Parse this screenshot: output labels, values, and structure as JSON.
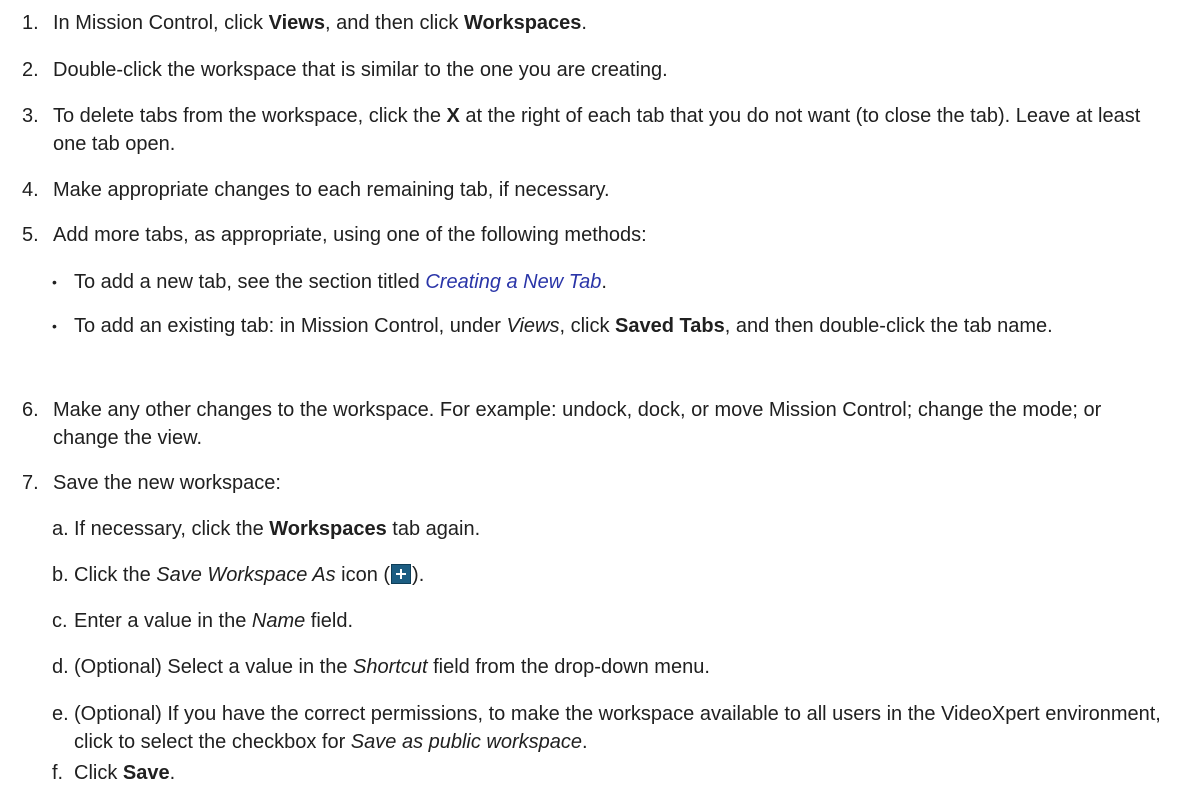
{
  "steps": [
    {
      "num": "1.",
      "t1": "In Mission Control, click ",
      "b1": "Views",
      "t2": ", and then click ",
      "b2": "Workspaces",
      "t3": "."
    },
    {
      "num": "2.",
      "text": "Double-click the workspace that is similar to the one you are creating."
    },
    {
      "num": "3.",
      "t1": "To delete tabs from the workspace, click the ",
      "b1": "X",
      "t2": " at the right of each tab that you do not want (to close the tab). Leave at least one tab open."
    },
    {
      "num": "4.",
      "text": "Make appropriate changes to each remaining tab, if necessary."
    },
    {
      "num": "5.",
      "text": "Add more tabs, as appropriate, using one of the following methods:"
    },
    {
      "num": "6.",
      "text": "Make any other changes to the workspace. For example: undock, dock, or move Mission Control; change the mode; or change the view."
    },
    {
      "num": "7.",
      "text": "Save the new workspace:"
    }
  ],
  "bullets": [
    {
      "marker": "•",
      "t1": "To add a new tab, see the section titled ",
      "link": "Creating a New Tab",
      "t2": "."
    },
    {
      "marker": "•",
      "t1": "To add an existing tab: in Mission Control, under ",
      "i1": "Views",
      "t2": ", click ",
      "b1": "Saved Tabs",
      "t3": ", and then double-click the tab name."
    }
  ],
  "substeps": [
    {
      "num": "a.",
      "t1": "If necessary, click the ",
      "b1": "Workspaces",
      "t2": " tab again."
    },
    {
      "num": "b.",
      "t1": "Click the ",
      "i1": "Save Workspace As",
      "t2": " icon (",
      "t3": ")."
    },
    {
      "num": "c.",
      "t1": "Enter a value in the ",
      "i1": "Name",
      "t2": " field."
    },
    {
      "num": "d.",
      "t1": "(Optional) Select a value in the ",
      "i1": "Shortcut",
      "t2": " field from the drop-down menu."
    },
    {
      "num": "e.",
      "t1": "(Optional) If you have the correct permissions, to make the workspace available to all users in the VideoXpert environment, click to select the checkbox for ",
      "i1": "Save as public workspace",
      "t2": "."
    },
    {
      "num": "f.",
      "t1": "Click ",
      "b1": "Save",
      "t2": "."
    }
  ],
  "icons": {
    "save_workspace_as": "plus-icon",
    "color": "#1c5d82"
  }
}
